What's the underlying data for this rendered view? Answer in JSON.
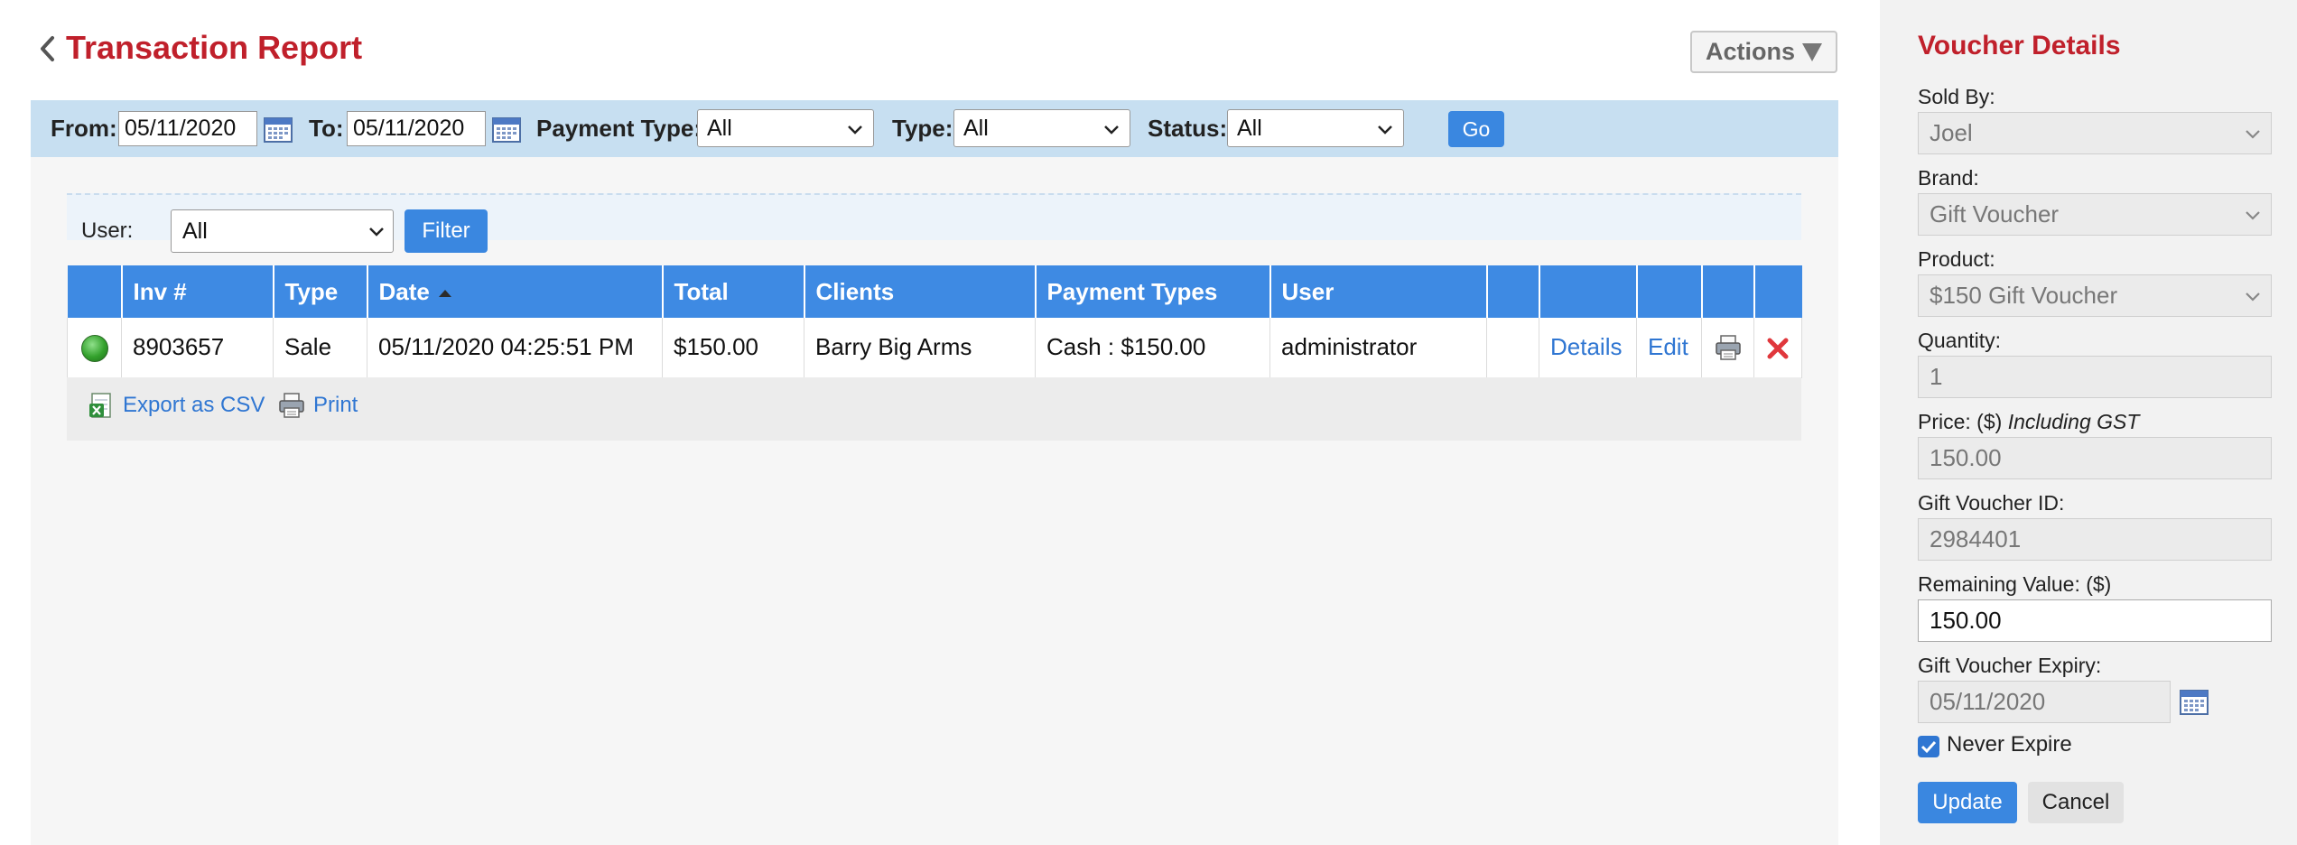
{
  "header": {
    "title": "Transaction Report",
    "actions_label": "Actions"
  },
  "filter_bar": {
    "from_label": "From:",
    "from_value": "05/11/2020",
    "to_label": "To:",
    "to_value": "05/11/2020",
    "payment_type_label": "Payment Type:",
    "payment_type_value": "All",
    "type_label": "Type:",
    "type_value": "All",
    "status_label": "Status:",
    "status_value": "All",
    "go_label": "Go"
  },
  "user_filter": {
    "label": "User:",
    "value": "All",
    "filter_label": "Filter"
  },
  "table": {
    "columns": [
      "",
      "Inv #",
      "Type",
      "Date",
      "Total",
      "Clients",
      "Payment Types",
      "User",
      "",
      "",
      "",
      "",
      ""
    ],
    "sorted_column": "Date",
    "rows": [
      {
        "status": "green",
        "inv": "8903657",
        "type": "Sale",
        "date": "05/11/2020 04:25:51 PM",
        "total": "$150.00",
        "client": "Barry Big Arms",
        "payment": "Cash : $150.00",
        "user": "administrator",
        "details_label": "Details",
        "edit_label": "Edit"
      }
    ]
  },
  "footer": {
    "export_label": "Export as CSV",
    "print_label": "Print"
  },
  "voucher": {
    "title": "Voucher Details",
    "sold_by_label": "Sold By:",
    "sold_by_value": "Joel",
    "brand_label": "Brand:",
    "brand_value": "Gift Voucher",
    "product_label": "Product:",
    "product_value": "$150 Gift Voucher",
    "quantity_label": "Quantity:",
    "quantity_value": "1",
    "price_label": "Price: ($)",
    "price_note": "Including GST",
    "price_value": "150.00",
    "voucher_id_label": "Gift Voucher ID:",
    "voucher_id_value": "2984401",
    "remaining_label": "Remaining Value: ($)",
    "remaining_value": "150.00",
    "expiry_label": "Gift Voucher Expiry:",
    "expiry_value": "05/11/2020",
    "never_expire_label": "Never Expire",
    "never_expire_checked": true,
    "update_label": "Update",
    "cancel_label": "Cancel"
  },
  "colors": {
    "brand_red": "#c0202b",
    "primary_blue": "#3a87e0",
    "filter_bar_bg": "#c7dff1",
    "status_ok": "#33a12c",
    "delete_red": "#e0373c"
  }
}
